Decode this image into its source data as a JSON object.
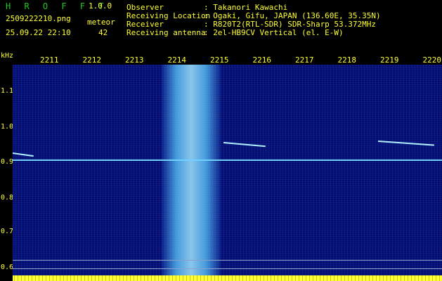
{
  "header": {
    "app_title": "H R O F F T",
    "app_version": "1.0.0",
    "file_name": "2509222210.png",
    "meteor_label": "meteor",
    "datetime": "25.09.22 22:10",
    "meteor_count": "42",
    "observer_label": "Observer",
    "observer_value": ": Takanori Kawachi",
    "location_label": "Receiving Location",
    "location_value": ": Ogaki, Gifu, JAPAN (136.60E, 35.35N)",
    "receiver_label": "Receiver",
    "receiver_value": ": R820T2(RTL-SDR) SDR-Sharp 53.372MHz",
    "antenna_label": "Receiving antenna",
    "antenna_value": ": 2el-HB9CV Vertical (el. E-W)"
  },
  "axes": {
    "y_unit": "kHz",
    "x_ticks": [
      "2211",
      "2212",
      "2213",
      "2214",
      "2215",
      "2216",
      "2217",
      "2218",
      "2219",
      "2220"
    ],
    "y_ticks": [
      "1.1",
      "1.0",
      "0.9",
      "0.8",
      "0.7",
      "0.6"
    ]
  },
  "colors": {
    "text": "#ffff33",
    "title": "#1ec81e",
    "background": "#060c6a"
  }
}
